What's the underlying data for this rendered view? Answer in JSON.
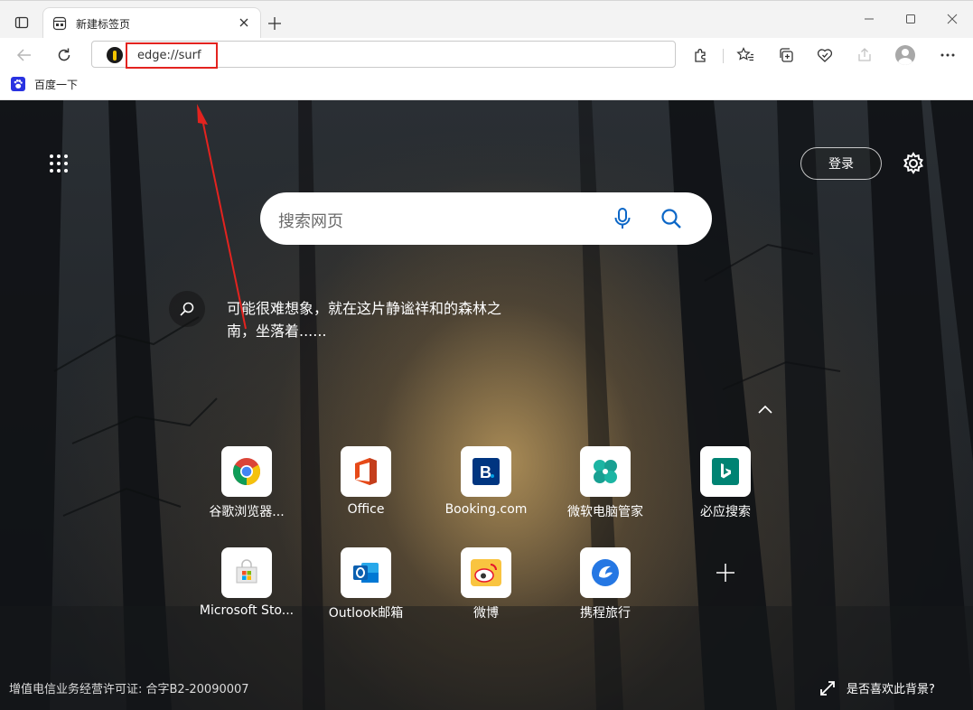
{
  "browser": {
    "tab": {
      "title": "新建标签页"
    },
    "address_bar": {
      "url": "edge://surf"
    },
    "bookmarks": [
      {
        "label": "百度一下"
      }
    ]
  },
  "ntp": {
    "signin_label": "登录",
    "search": {
      "placeholder": "搜索网页"
    },
    "explore_text": "可能很难想象，就在这片静谧祥和的森林之南，坐落着......",
    "quick_links": [
      {
        "label": "谷歌浏览器...",
        "icon": "chrome-icon"
      },
      {
        "label": "Office",
        "icon": "office-icon"
      },
      {
        "label": "Booking.com",
        "icon": "booking-icon"
      },
      {
        "label": "微软电脑管家",
        "icon": "pc-manager-icon"
      },
      {
        "label": "必应搜索",
        "icon": "bing-icon"
      },
      {
        "label": "Microsoft Sto...",
        "icon": "store-icon"
      },
      {
        "label": "Outlook邮箱",
        "icon": "outlook-icon"
      },
      {
        "label": "微博",
        "icon": "weibo-icon"
      },
      {
        "label": "携程旅行",
        "icon": "ctrip-icon"
      }
    ],
    "license": "增值电信业务经营许可证: 合字B2-20090007",
    "background_like": "是否喜欢此背景?"
  },
  "colors": {
    "highlight_red": "#e3231f",
    "arrow_red": "#e3231f",
    "booking_blue": "#003580",
    "bing_teal": "#008373"
  }
}
